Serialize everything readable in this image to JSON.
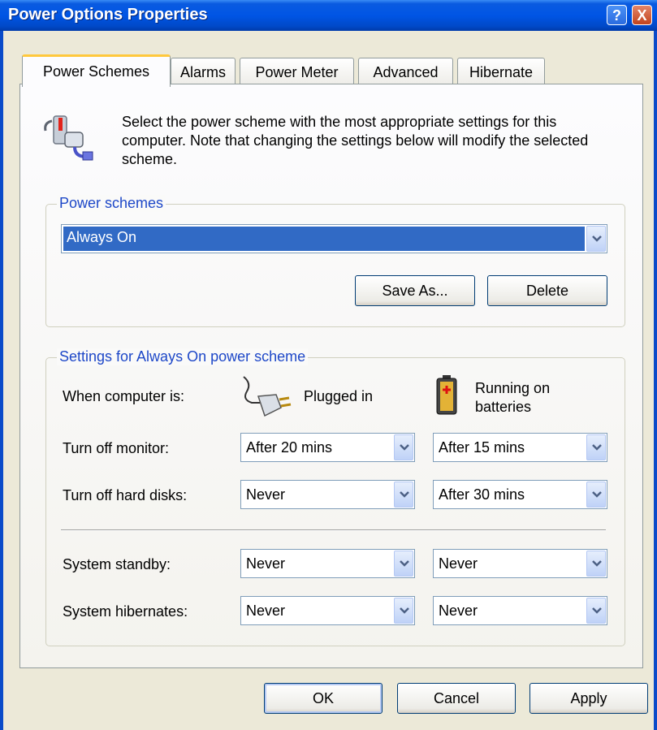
{
  "window": {
    "title": "Power Options Properties"
  },
  "tabs": [
    "Power Schemes",
    "Alarms",
    "Power Meter",
    "Advanced",
    "Hibernate"
  ],
  "description": "Select the power scheme with the most appropriate settings for this computer. Note that changing the settings below will modify the selected scheme.",
  "power_schemes": {
    "group_label": "Power schemes",
    "selected": "Always On",
    "save_as_label": "Save As...",
    "delete_label": "Delete"
  },
  "settings": {
    "group_label": "Settings for Always On power scheme",
    "when_label": "When computer is:",
    "plugged_label": "Plugged in",
    "battery_label_line1": "Running on",
    "battery_label_line2": "batteries",
    "rows": [
      {
        "label": "Turn off monitor:",
        "plugged": "After 20 mins",
        "battery": "After 15 mins"
      },
      {
        "label": "Turn off hard disks:",
        "plugged": "Never",
        "battery": "After 30 mins"
      },
      {
        "label": "System standby:",
        "plugged": "Never",
        "battery": "Never"
      },
      {
        "label": "System hibernates:",
        "plugged": "Never",
        "battery": "Never"
      }
    ]
  },
  "buttons": {
    "ok": "OK",
    "cancel": "Cancel",
    "apply": "Apply"
  },
  "icons": {
    "help": "?",
    "close": "X"
  },
  "colors": {
    "titlebar": "#0055E5",
    "selection": "#316AC5",
    "tab_highlight": "#FFC83C",
    "group_label": "#1E48C8"
  }
}
